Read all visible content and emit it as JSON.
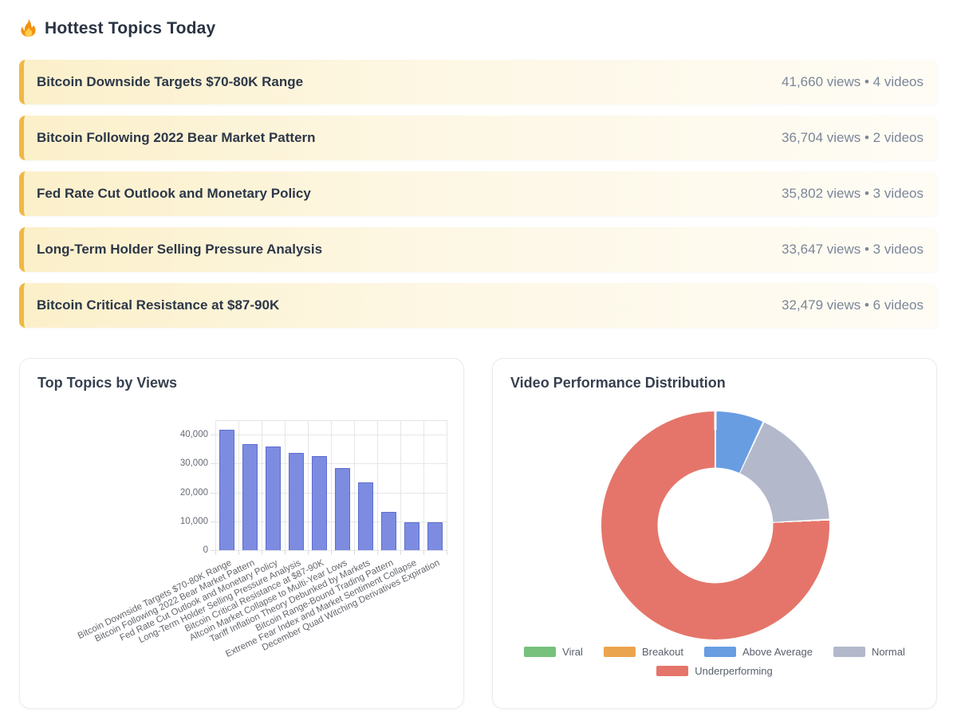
{
  "page": {
    "title": "Hottest Topics Today",
    "title_icon": "fire-icon"
  },
  "topics": {
    "items": [
      {
        "title": "Bitcoin Downside Targets $70-80K Range",
        "meta": "41,660 views • 4 videos"
      },
      {
        "title": "Bitcoin Following 2022 Bear Market Pattern",
        "meta": "36,704 views • 2 videos"
      },
      {
        "title": "Fed Rate Cut Outlook and Monetary Policy",
        "meta": "35,802 views • 3 videos"
      },
      {
        "title": "Long-Term Holder Selling Pressure Analysis",
        "meta": "33,647 views • 3 videos"
      },
      {
        "title": "Bitcoin Critical Resistance at $87-90K",
        "meta": "32,479 views • 6 videos"
      }
    ]
  },
  "colors": {
    "topic_accent": "#efb845",
    "bar_fill": "#7d8ce0",
    "bar_border": "#5b6ed0",
    "grid": "#e6e6e6"
  },
  "chart_data": [
    {
      "type": "bar",
      "title": "Top Topics by Views",
      "categories": [
        "Bitcoin Downside Targets $70-80K Range",
        "Bitcoin Following 2022 Bear Market Pattern",
        "Fed Rate Cut Outlook and Monetary Policy",
        "Long-Term Holder Selling Pressure Analysis",
        "Bitcoin Critical Resistance at $87-90K",
        "Altcoin Market Collapse to Multi-Year Lows",
        "Tariff Inflation Theory Debunked by Markets",
        "Bitcoin Range-Bound Trading Pattern",
        "Extreme Fear Index and Market Sentiment Collapse",
        "December Quad Witching Derivatives Expiration"
      ],
      "values": [
        41660,
        36704,
        35802,
        33647,
        32479,
        28300,
        23400,
        13200,
        9700,
        9700
      ],
      "xlabel": "",
      "ylabel": "",
      "ylim": [
        0,
        45000
      ],
      "yticks": [
        0,
        10000,
        20000,
        30000,
        40000
      ],
      "ytick_labels": [
        "0",
        "10,000",
        "20,000",
        "30,000",
        "40,000"
      ],
      "grid": true,
      "legend": false,
      "x_label_rotation_deg": -26
    },
    {
      "type": "pie",
      "subtype": "donut",
      "title": "Video Performance Distribution",
      "labels": [
        "Viral",
        "Breakout",
        "Above Average",
        "Normal",
        "Underperforming"
      ],
      "values": [
        0,
        0,
        2,
        5,
        22
      ],
      "colors": [
        "#77c17d",
        "#eba44e",
        "#689de2",
        "#b3b9cb",
        "#e5756a"
      ],
      "legend_position": "bottom",
      "cutout_percent": 50,
      "start_angle_deg": 0
    }
  ]
}
